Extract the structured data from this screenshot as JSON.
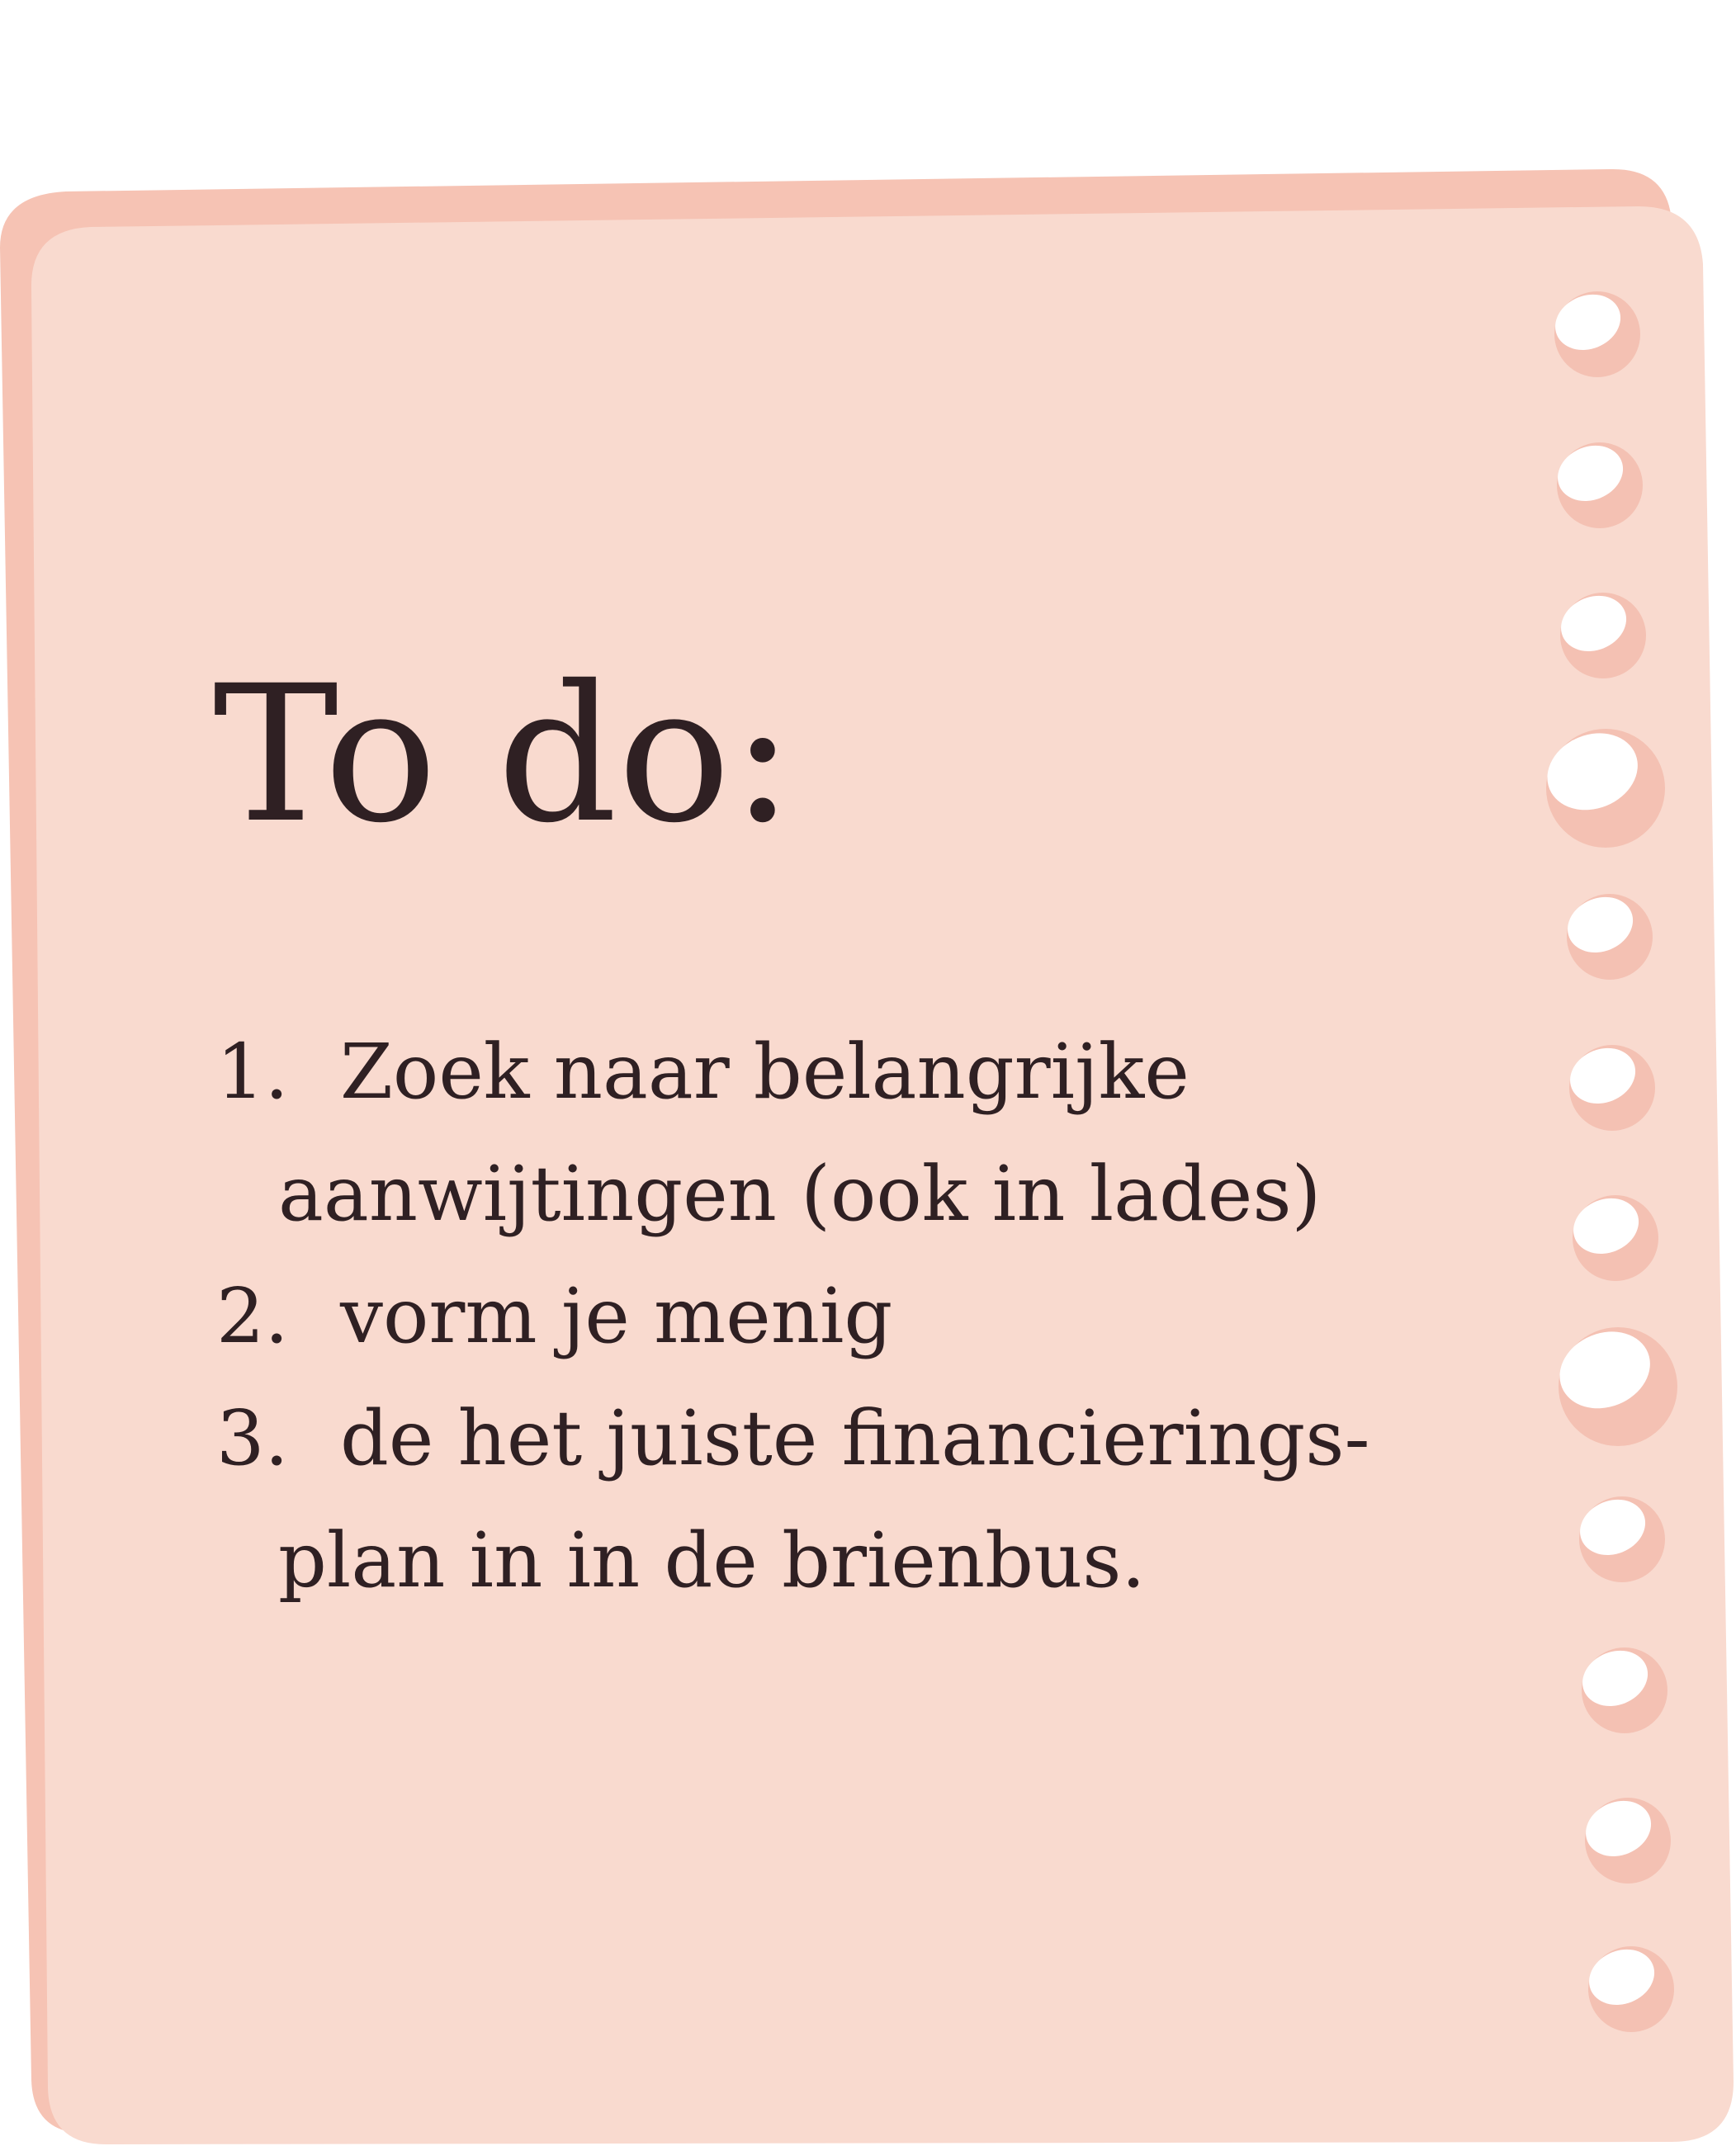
{
  "note": {
    "title": "To do:",
    "items": [
      {
        "number": "1.",
        "lines": [
          "Zoek naar belangrijke",
          "aanwijtingen (ook in lades)"
        ]
      },
      {
        "number": "2.",
        "lines": [
          "vorm je menig"
        ]
      },
      {
        "number": "3.",
        "lines": [
          "de het juiste financierings-",
          "plan in in de brienbus."
        ]
      }
    ]
  },
  "colors": {
    "paper_back": "#f6c3b4",
    "paper_front": "#f9dacf",
    "hole_shadow": "#f4c1b3",
    "hole": "#ffffff",
    "text": "#2f2023"
  },
  "icons": {
    "binder_holes": "punched-hole-icon"
  }
}
